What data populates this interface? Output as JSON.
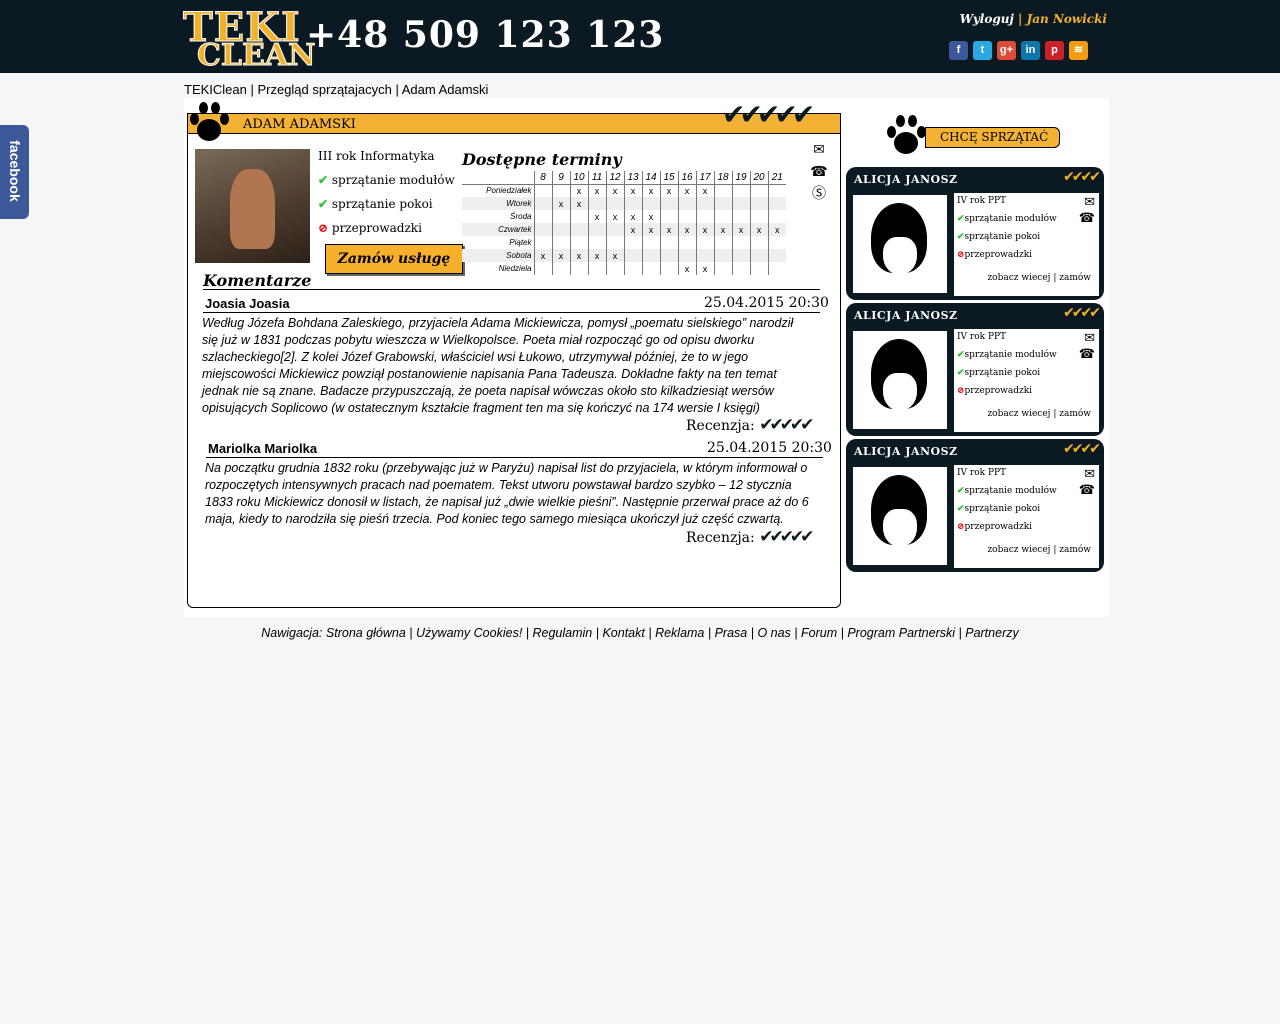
{
  "header": {
    "logo_top": "TEKI",
    "logo_bottom": "CLEAN",
    "phone": "+48 509 123 123",
    "logout": "Wyloguj",
    "separator": "|",
    "user_name": "Jan Nowicki",
    "social": [
      {
        "icon": "facebook-icon",
        "glyph": "f",
        "color": "#3b5998"
      },
      {
        "icon": "twitter-icon",
        "glyph": "t",
        "color": "#2aa9e0"
      },
      {
        "icon": "google-plus-icon",
        "glyph": "g+",
        "color": "#dd4b39"
      },
      {
        "icon": "linkedin-icon",
        "glyph": "in",
        "color": "#0e76a8"
      },
      {
        "icon": "pinterest-icon",
        "glyph": "p",
        "color": "#cb2027"
      },
      {
        "icon": "rss-icon",
        "glyph": "≋",
        "color": "#f39c12"
      }
    ]
  },
  "breadcrumb": "TEKIClean | Przegląd sprzątajacych | Adam Adamski",
  "facebook_tab": "facebook",
  "profile": {
    "name": "ADAM ADAMSKI",
    "rating_checks": "✔✔✔✔✔",
    "study": "III rok Informatyka",
    "services": [
      {
        "label": "sprzątanie modułów",
        "available": true
      },
      {
        "label": "sprzątanie pokoi",
        "available": true
      },
      {
        "label": "przeprowadzki",
        "available": false
      }
    ],
    "order_button": "Zamów usługę",
    "schedule_title": "Dostępne terminy",
    "hours": [
      "8",
      "9",
      "10",
      "11",
      "12",
      "13",
      "14",
      "15",
      "16",
      "17",
      "18",
      "19",
      "20",
      "21"
    ],
    "days": [
      {
        "name": "Poniedziałek",
        "slots": [
          "",
          "",
          "x",
          "x",
          "x",
          "x",
          "x",
          "x",
          "x",
          "x",
          "",
          "",
          "",
          ""
        ]
      },
      {
        "name": "Wtorek",
        "slots": [
          "",
          "x",
          "x",
          "",
          "",
          "",
          "",
          "",
          "",
          "",
          "",
          "",
          "",
          ""
        ]
      },
      {
        "name": "Środa",
        "slots": [
          "",
          "",
          "",
          "x",
          "x",
          "x",
          "x",
          "",
          "",
          "",
          "",
          "",
          "",
          ""
        ]
      },
      {
        "name": "Czwartek",
        "slots": [
          "",
          "",
          "",
          "",
          "",
          "x",
          "x",
          "x",
          "x",
          "x",
          "x",
          "x",
          "x",
          "x"
        ]
      },
      {
        "name": "Piątek",
        "slots": [
          "",
          "",
          "",
          "",
          "",
          "",
          "",
          "",
          "",
          "",
          "",
          "",
          "",
          ""
        ]
      },
      {
        "name": "Sobota",
        "slots": [
          "x",
          "x",
          "x",
          "x",
          "x",
          "",
          "",
          "",
          "",
          "",
          "",
          "",
          "",
          ""
        ]
      },
      {
        "name": "Niedziela",
        "slots": [
          "",
          "",
          "",
          "",
          "",
          "",
          "",
          "",
          "x",
          "x",
          "",
          "",
          "",
          ""
        ]
      }
    ],
    "contact_icons": [
      {
        "icon": "mail-icon",
        "glyph": "✉"
      },
      {
        "icon": "phone-icon",
        "glyph": "☎"
      },
      {
        "icon": "skype-icon",
        "glyph": "Ⓢ"
      }
    ]
  },
  "comments_title": "Komentarze",
  "comments": [
    {
      "author": "Joasia Joasia",
      "date": "25.04.2015 20:30",
      "text": "Według Józefa Bohdana Zaleskiego, przyjaciela Adama Mickiewicza, pomysł „poematu sielskiego” narodził się już w 1831 podczas pobytu wieszcza w Wielkopolsce. Poeta miał rozpocząć go od opisu dworku szlacheckiego[2]. Z kolei Józef Grabowski, właściciel wsi Łukowo, utrzymywał później, że to w jego miejscowości Mickiewicz powziął postanowienie napisania Pana Tadeusza. Dokładne fakty na ten temat jednak nie są znane. Badacze przypuszczają, że poeta napisał wówczas około sto kilkadziesiąt wersów opisujących Soplicowo (w ostatecznym kształcie fragment ten ma się kończyć na 174 wersie I księgi)",
      "review_label": "Recenzja:",
      "review": "✔✔✔✔✔"
    },
    {
      "author": "Mariolka Mariolka",
      "date": "25.04.2015 20:30",
      "text": "Na początku grudnia 1832 roku (przebywając już w Paryżu) napisał list do przyjaciela, w którym informował o rozpoczętych intensywnych pracach nad poematem. Tekst utworu powstawał bardzo szybko – 12 stycznia 1833 roku Mickiewicz donosił w listach, że napisał już „dwie wielkie pieśni”. Następnie przerwał prace aż do 6 maja, kiedy to narodziła się pieśń trzecia. Pod koniec tego samego miesiąca ukończył już część czwartą.",
      "review_label": "Recenzja:",
      "review": "✔✔✔✔✔"
    }
  ],
  "sidebar": {
    "want_clean": "CHCĘ SPRZĄTAĆ",
    "cards": [
      {
        "name": "ALICJA JANOSZ",
        "checks": "✔✔✔✔",
        "study": "IV rok PPT",
        "s1": "sprzątanie modułów",
        "s2": "sprzątanie pokoi",
        "s3": "przeprowadzki",
        "see_more": "zobacz wiecej",
        "sep": "|",
        "order": "zamów"
      },
      {
        "name": "ALICJA JANOSZ",
        "checks": "✔✔✔✔",
        "study": "IV rok PPT",
        "s1": "sprzątanie modułów",
        "s2": "sprzątanie pokoi",
        "s3": "przeprowadzki",
        "see_more": "zobacz wiecej",
        "sep": "|",
        "order": "zamów"
      },
      {
        "name": "ALICJA JANOSZ",
        "checks": "✔✔✔✔",
        "study": "IV rok PPT",
        "s1": "sprzątanie modułów",
        "s2": "sprzątanie pokoi",
        "s3": "przeprowadzki",
        "see_more": "zobacz wiecej",
        "sep": "|",
        "order": "zamów"
      }
    ]
  },
  "footer": {
    "prefix": "Nawigacja:",
    "links": [
      "Strona główna",
      "Używamy Cookies!",
      "Regulamin",
      "Kontakt",
      "Reklama",
      "Prasa",
      "O nas",
      "Forum",
      "Program Partnerski",
      "Partnerzy"
    ]
  },
  "colors": {
    "dark": "#0b1a22",
    "accent": "#f4b234",
    "ok": "#2cc32c",
    "no": "#e00000"
  }
}
